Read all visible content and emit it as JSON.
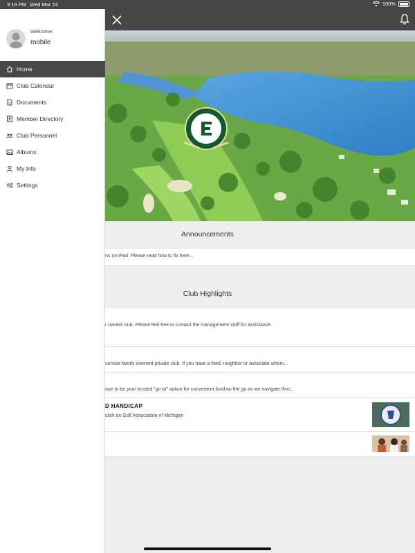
{
  "status": {
    "time": "3:19 PM",
    "date": "Wed Mar 24",
    "battery": "100%"
  },
  "drawer": {
    "welcome": "Welcome,",
    "username": "mobile",
    "items": [
      {
        "label": "Home",
        "icon": "home-icon",
        "active": true
      },
      {
        "label": "Club Calendar",
        "icon": "calendar-icon"
      },
      {
        "label": "Documents",
        "icon": "document-icon"
      },
      {
        "label": "Member Directory",
        "icon": "directory-icon"
      },
      {
        "label": "Club Personnel",
        "icon": "people-icon"
      },
      {
        "label": "Albums",
        "icon": "album-icon"
      },
      {
        "label": "My Info",
        "icon": "user-icon"
      },
      {
        "label": "Settings",
        "icon": "settings-icon"
      }
    ]
  },
  "main": {
    "announcements_title": "Announcements",
    "announcement_text": "ns on iPad. Please read how to fix here...",
    "highlights_title": "Club Highlights",
    "highlights": [
      {
        "text": "r owned club.   Please feel free to contact the management staff for assistance."
      },
      {
        "text": "service family oriented private club.  If you have a fried, neighbor or associate whom..."
      },
      {
        "text": "nue to be your trusted \"go to\" option for convenient food on the go as we navigate thro..."
      },
      {
        "title": "D HANDICAP",
        "text": "click on Golf Association of Michigan"
      }
    ]
  },
  "colors": {
    "bar": "#464646",
    "active_menu": "#474747",
    "lake": "#3f8fd2",
    "grass": "#5aa838"
  }
}
